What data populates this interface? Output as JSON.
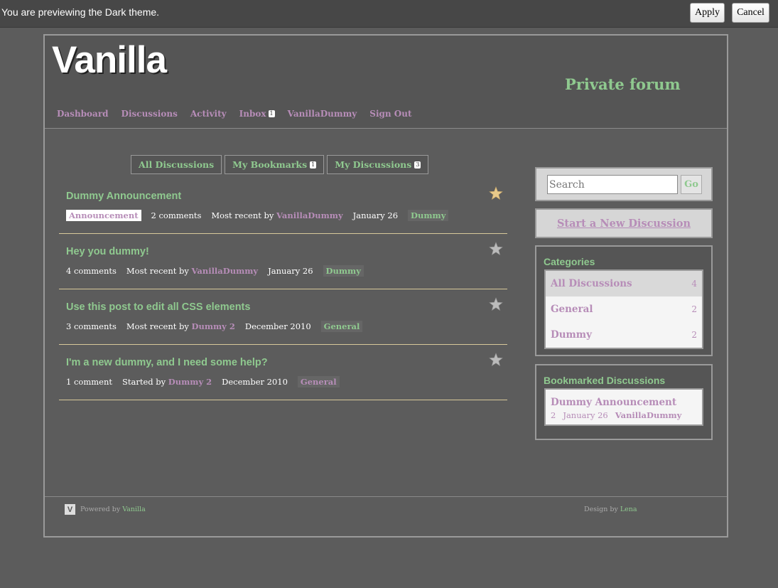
{
  "preview": {
    "text": "You are previewing the Dark theme.",
    "apply_label": "Apply",
    "cancel_label": "Cancel"
  },
  "header": {
    "logo": "Vanilla",
    "tagline": "Private forum",
    "menu": [
      {
        "label": "Dashboard"
      },
      {
        "label": "Discussions"
      },
      {
        "label": "Activity"
      },
      {
        "label": "Inbox",
        "count": "1"
      },
      {
        "label": "VanillaDummy"
      },
      {
        "label": "Sign Out"
      }
    ]
  },
  "tabs": [
    {
      "label": "All Discussions"
    },
    {
      "label": "My Bookmarks",
      "count": "1"
    },
    {
      "label": "My Discussions",
      "count": "3"
    }
  ],
  "discussions": [
    {
      "title": "Dummy Announcement",
      "announcement": "Announcement",
      "comments": "2 comments",
      "recent_prefix": "Most recent by",
      "user": "VanillaDummy",
      "date": "January 26",
      "category": "Dummy",
      "bookmarked": true
    },
    {
      "title": "Hey you dummy!",
      "comments": "4 comments",
      "recent_prefix": "Most recent by",
      "user": "VanillaDummy",
      "date": "January 26",
      "category": "Dummy",
      "bookmarked": false
    },
    {
      "title": "Use this post to edit all CSS elements",
      "comments": "3 comments",
      "recent_prefix": "Most recent by",
      "user": "Dummy 2",
      "date": "December 2010",
      "category": "General",
      "bookmarked": false
    },
    {
      "title": "I'm a new dummy, and I need some help?",
      "comments": "1 comment",
      "recent_prefix": "Started by",
      "user": "Dummy 2",
      "date": "December 2010",
      "category": "General",
      "bookmarked": false
    }
  ],
  "sidebar": {
    "search_placeholder": "Search",
    "go_label": "Go",
    "new_discussion": "Start a New Discussion",
    "categories_title": "Categories",
    "categories": [
      {
        "label": "All Discussions",
        "count": "4"
      },
      {
        "label": "General",
        "count": "2"
      },
      {
        "label": "Dummy",
        "count": "2"
      }
    ],
    "bookmarks_title": "Bookmarked Discussions",
    "bookmark": {
      "title": "Dummy Announcement",
      "count": "2",
      "date": "January 26",
      "user": "VanillaDummy"
    }
  },
  "footer": {
    "powered_by": "Powered by",
    "vanilla": "Vanilla",
    "design_by": "Design by",
    "designer": "Lena"
  },
  "colors": {
    "accent_green": "#8fc98f",
    "accent_purple": "#b78db8",
    "star_bookmarked": "#e8c98a",
    "star_default": "#bbbbbb"
  }
}
